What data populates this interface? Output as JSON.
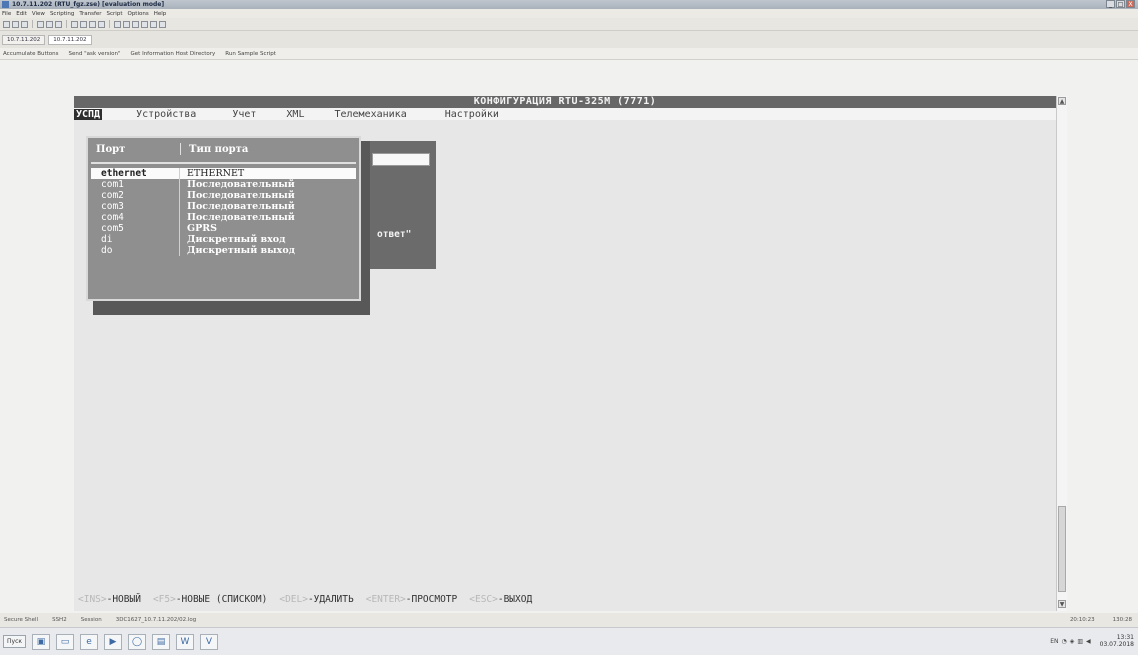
{
  "window": {
    "title": "10.7.11.202 (RTU_fgz.zse) [evaluation mode]",
    "minimize": "_",
    "maximize": "□",
    "close": "X"
  },
  "menubar": [
    "File",
    "Edit",
    "View",
    "Scripting",
    "Transfer",
    "Script",
    "Options",
    "Help"
  ],
  "session_tabs": [
    "10.7.11.202",
    "10.7.11.202"
  ],
  "links": [
    "Accumulate Buttons",
    "Send \"ask version\"",
    "Get Information Host Directory",
    "Run Sample Script"
  ],
  "terminal": {
    "title": "КОНФИГУРАЦИЯ RTU-325M (7771)",
    "menu": [
      "УСПД",
      "Устройства",
      "Учет",
      "XML",
      "Телемеханика",
      "Настройки"
    ],
    "selected_menu": "УСПД",
    "background_text": "ответ\"",
    "popup": {
      "col_port": "Порт",
      "col_type": "Тип порта",
      "rows": [
        {
          "port": "ethernet",
          "type": "ETHERNET"
        },
        {
          "port": "com1",
          "type": "Последовательный"
        },
        {
          "port": "com2",
          "type": "Последовательный"
        },
        {
          "port": "com3",
          "type": "Последовательный"
        },
        {
          "port": "com4",
          "type": "Последовательный"
        },
        {
          "port": "com5",
          "type": "GPRS"
        },
        {
          "port": "di",
          "type": "Дискретный вход"
        },
        {
          "port": "do",
          "type": "Дискретный выход"
        }
      ],
      "selected_row": 0
    },
    "status": {
      "ins": "<INS>",
      "ins_label": "-НОВЫЙ",
      "f5": "<F5>",
      "f5_label": "-НОВЫЕ (СПИСКОМ)",
      "del": "<DEL>",
      "del_label": "-УДАЛИТЬ",
      "enter": "<ENTER>",
      "enter_label": "-ПРОСМОТР",
      "esc": "<ESC>",
      "esc_label": "-ВЫХОД"
    }
  },
  "appstatus": {
    "left": [
      "Secure Shell",
      "SSH2",
      "Session",
      "3DC1627_10.7.11.202/02.log"
    ],
    "right": [
      "20:10:23",
      "130:28"
    ]
  },
  "taskbar": {
    "start": "Пуск",
    "lang": "EN",
    "time": "13:31",
    "date": "03.07.2018"
  }
}
